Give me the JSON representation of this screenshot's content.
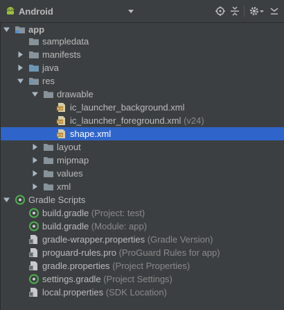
{
  "toolbar": {
    "title": "Android"
  },
  "tree": {
    "app": "app",
    "sampledata": "sampledata",
    "manifests": "manifests",
    "java": "java",
    "res": "res",
    "drawable": "drawable",
    "ic_bg": "ic_launcher_background.xml",
    "ic_fg": "ic_launcher_foreground.xml",
    "ic_fg_hint": "(v24)",
    "shape": "shape.xml",
    "layout": "layout",
    "mipmap": "mipmap",
    "values": "values",
    "xml": "xml",
    "gradle_scripts": "Gradle Scripts",
    "build_project": "build.gradle",
    "build_project_hint": "(Project: test)",
    "build_module": "build.gradle",
    "build_module_hint": "(Module: app)",
    "wrapper": "gradle-wrapper.properties",
    "wrapper_hint": "(Gradle Version)",
    "proguard": "proguard-rules.pro",
    "proguard_hint": "(ProGuard Rules for app)",
    "gradle_props": "gradle.properties",
    "gradle_props_hint": "(Project Properties)",
    "settings": "settings.gradle",
    "settings_hint": "(Project Settings)",
    "local": "local.properties",
    "local_hint": "(SDK Location)"
  },
  "colors": {
    "background": "#3c3f41",
    "selection": "#2f65ca",
    "text": "#bbbbbb",
    "hint": "#8a8a8a",
    "folder": "#87939a",
    "res_folder": "#6c97b3",
    "gradle_green": "#4caf50"
  },
  "icons": {
    "android": "android-icon",
    "dropdown": "chevron-down-icon",
    "scroll_from_source": "target-icon",
    "collapse_all": "collapse-all-icon",
    "settings": "gear-icon",
    "hide": "hide-panel-icon",
    "folder": "folder-icon",
    "xml_file": "xml-file-icon",
    "gradle": "gradle-icon",
    "properties_file": "properties-file-icon"
  }
}
